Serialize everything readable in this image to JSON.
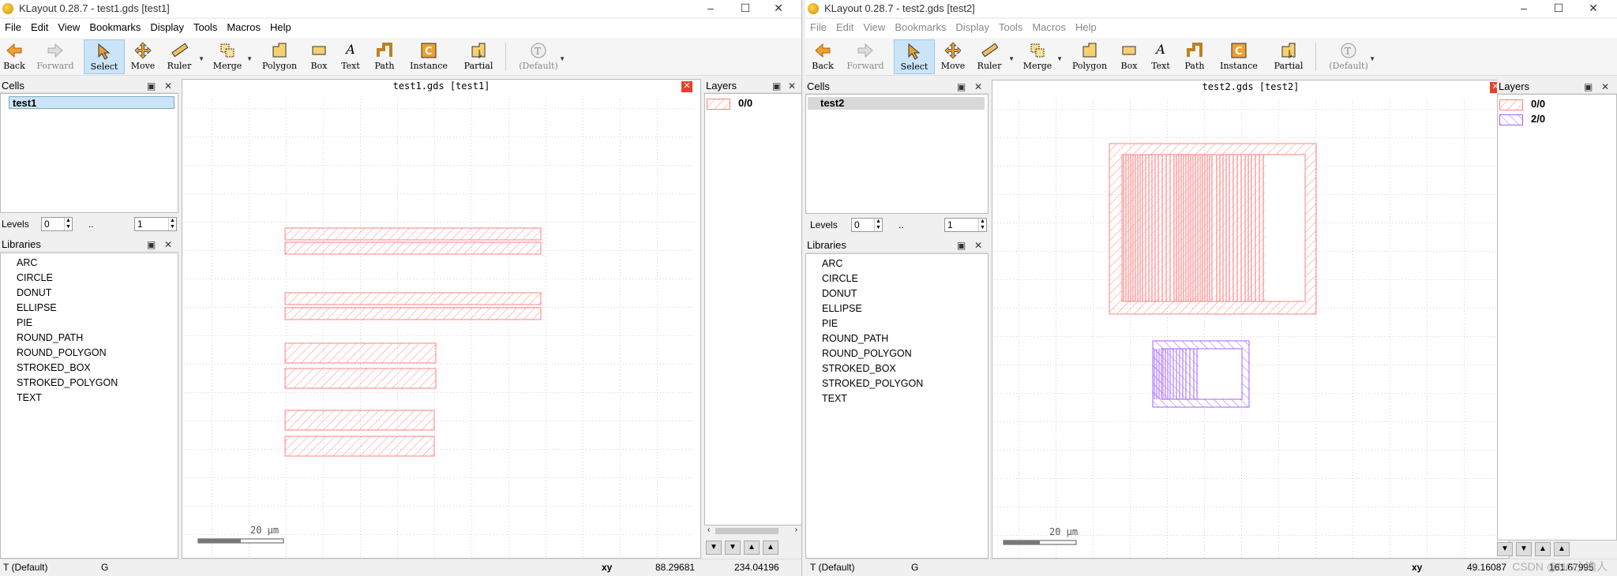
{
  "left": {
    "title": "KLayout 0.28.7 - test1.gds [test1]",
    "menu": [
      "File",
      "Edit",
      "View",
      "Bookmarks",
      "Display",
      "Tools",
      "Macros",
      "Help"
    ],
    "toolbar": [
      "Back",
      "Forward",
      "Select",
      "Move",
      "Ruler",
      "Merge",
      "Polygon",
      "Box",
      "Text",
      "Path",
      "Instance",
      "Partial",
      "(Default)"
    ],
    "cells_header": "Cells",
    "cell": "test1",
    "levels_label": "Levels",
    "level_from": "0",
    "level_sep": "..",
    "level_to": "1",
    "libraries_header": "Libraries",
    "libraries": [
      "ARC",
      "CIRCLE",
      "DONUT",
      "ELLIPSE",
      "PIE",
      "ROUND_PATH",
      "ROUND_POLYGON",
      "STROKED_BOX",
      "STROKED_POLYGON",
      "TEXT"
    ],
    "canvas_title": "test1.gds [test1]",
    "scale_label": "20 µm",
    "layers_header": "Layers",
    "layers": [
      {
        "name": "0/0",
        "color": "#ff8080"
      }
    ],
    "status": {
      "mode": "T (Default)",
      "grid": "G",
      "xy_label": "xy",
      "x": "88.29681",
      "y": "234.04196"
    }
  },
  "right": {
    "title": "KLayout 0.28.7 - test2.gds [test2]",
    "menu": [
      "File",
      "Edit",
      "View",
      "Bookmarks",
      "Display",
      "Tools",
      "Macros",
      "Help"
    ],
    "toolbar": [
      "Back",
      "Forward",
      "Select",
      "Move",
      "Ruler",
      "Merge",
      "Polygon",
      "Box",
      "Text",
      "Path",
      "Instance",
      "Partial",
      "(Default)"
    ],
    "cells_header": "Cells",
    "cell": "test2",
    "levels_label": "Levels",
    "level_from": "0",
    "level_sep": "..",
    "level_to": "1",
    "libraries_header": "Libraries",
    "libraries": [
      "ARC",
      "CIRCLE",
      "DONUT",
      "ELLIPSE",
      "PIE",
      "ROUND_PATH",
      "ROUND_POLYGON",
      "STROKED_BOX",
      "STROKED_POLYGON",
      "TEXT"
    ],
    "canvas_title": "test2.gds [test2]",
    "scale_label": "20 µm",
    "layers_header": "Layers",
    "layers": [
      {
        "name": "0/0",
        "color": "#ff8080"
      },
      {
        "name": "2/0",
        "color": "#a060ff"
      }
    ],
    "status": {
      "mode": "T (Default)",
      "grid": "G",
      "xy_label": "xy",
      "x": "49.16087",
      "y": "161.67995"
    },
    "watermark": "CSDN @NG小逸人"
  }
}
